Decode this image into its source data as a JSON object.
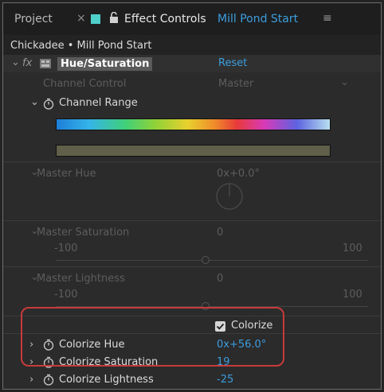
{
  "tabs": {
    "project": "Project",
    "close": "×",
    "effect_controls": "Effect Controls",
    "composition": "Mill Pond Start",
    "menu": "≡"
  },
  "layer_header": "Chickadee • Mill Pond Start",
  "effect": {
    "fx": "fx",
    "name": "Hue/Saturation",
    "reset": "Reset"
  },
  "channel_control": {
    "label": "Channel Control",
    "value": "Master"
  },
  "channel_range": {
    "label": "Channel Range"
  },
  "master_hue": {
    "label": "Master Hue",
    "value": "0x+0.0°"
  },
  "master_saturation": {
    "label": "Master Saturation",
    "value": "0",
    "min": "-100",
    "max": "100"
  },
  "master_lightness": {
    "label": "Master Lightness",
    "value": "0",
    "min": "-100",
    "max": "100"
  },
  "colorize": {
    "label": "Colorize",
    "checked": true
  },
  "colorize_hue": {
    "label": "Colorize Hue",
    "value": "0x+56.0°"
  },
  "colorize_saturation": {
    "label": "Colorize Saturation",
    "value": "19"
  },
  "colorize_lightness": {
    "label": "Colorize Lightness",
    "value": "-25"
  },
  "colors": {
    "accent_blue": "#3c9dde",
    "highlight_red": "#c83a3a",
    "swatch_cyan": "#4fd0cc",
    "colorized_bar": "#5f5f4a"
  }
}
